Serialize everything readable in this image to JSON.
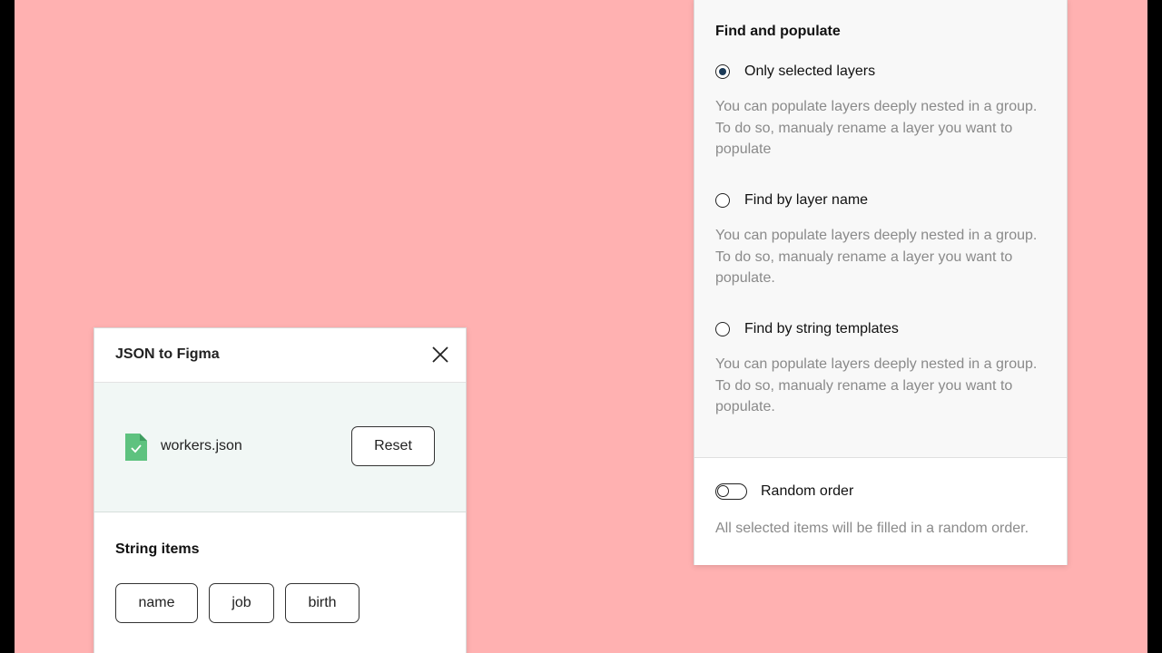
{
  "plugin_panel": {
    "title": "JSON to Figma",
    "close_icon": "close-icon",
    "file": {
      "name": "workers.json",
      "icon": "file-check-icon",
      "icon_color": "#5ec27f"
    },
    "reset_label": "Reset",
    "string_items_title": "String items",
    "string_items": [
      "name",
      "job",
      "birth"
    ]
  },
  "settings_panel": {
    "title": "Find and populate",
    "options": [
      {
        "label": "Only selected layers",
        "selected": true,
        "description": "You can populate layers deeply nested in a group. To do so, manualy rename a layer you want to populate"
      },
      {
        "label": "Find by layer name",
        "selected": false,
        "description": "You can populate layers deeply nested in a group. To do so, manualy rename a layer you want to populate."
      },
      {
        "label": "Find by string templates",
        "selected": false,
        "description": "You can populate layers deeply nested in a group. To do so, manualy rename a layer you want to populate."
      }
    ],
    "random_order": {
      "label": "Random order",
      "enabled": false,
      "description": "All selected items will be filled in a random order."
    }
  },
  "colors": {
    "background": "#ffb1b1",
    "file_area": "#f1f7f5",
    "radio_selected": "#1b3a57",
    "muted_text": "#8a8a8a"
  }
}
